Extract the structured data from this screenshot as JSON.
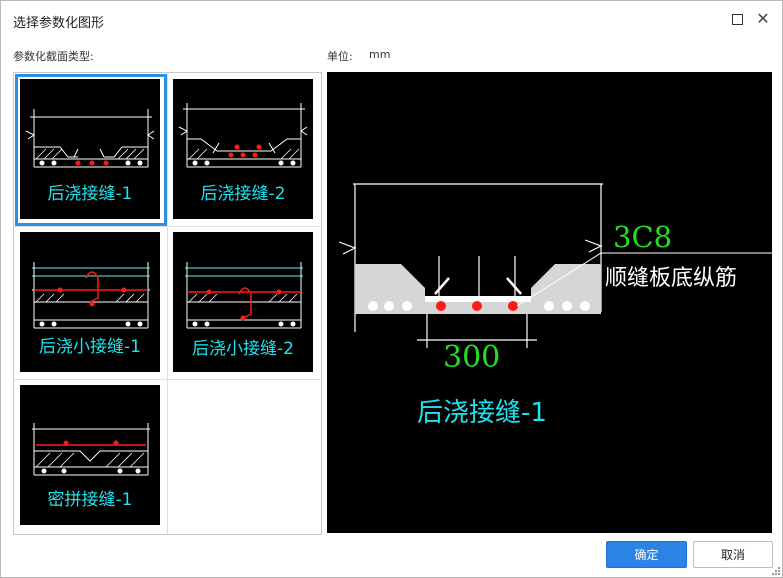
{
  "dialog": {
    "title": "选择参数化图形",
    "section_label": "参数化截面类型:",
    "unit_label": "单位:",
    "unit_value": "mm"
  },
  "thumbnails": [
    {
      "caption": "后浇接缝-1",
      "selected": true
    },
    {
      "caption": "后浇接缝-2",
      "selected": false
    },
    {
      "caption": "后浇小接缝-1",
      "selected": false
    },
    {
      "caption": "后浇小接缝-2",
      "selected": false
    },
    {
      "caption": "密拼接缝-1",
      "selected": false
    }
  ],
  "preview": {
    "rebar_spec": "3C8",
    "rebar_desc": "顺缝板底纵筋",
    "width_dim": "300",
    "caption": "后浇接缝-1"
  },
  "buttons": {
    "ok": "确定",
    "cancel": "取消"
  },
  "colors": {
    "accent": "#2b83e5",
    "caption_cyan": "#1ee3ef",
    "dim_green": "#22dd22",
    "rebar_red": "#ff1a1a"
  }
}
